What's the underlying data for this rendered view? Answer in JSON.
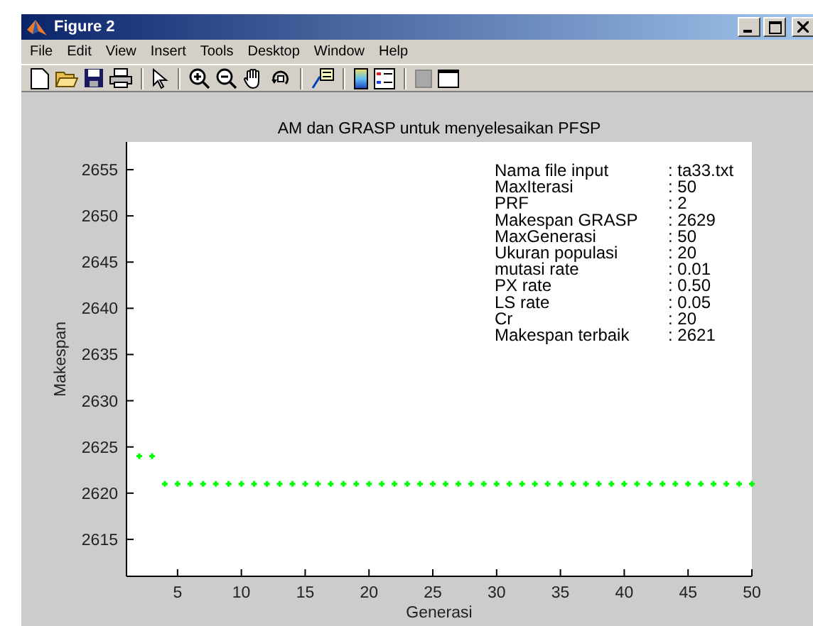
{
  "window": {
    "title": "Figure 2"
  },
  "menu": [
    "File",
    "Edit",
    "View",
    "Insert",
    "Tools",
    "Desktop",
    "Window",
    "Help"
  ],
  "figure": {
    "info": [
      {
        "label": "Nama file input",
        "value": ": ta33.txt"
      },
      {
        "label": "MaxIterasi",
        "value": ": 50"
      },
      {
        "label": "PRF",
        "value": ": 2"
      },
      {
        "label": "Makespan GRASP",
        "value": ": 2629"
      },
      {
        "label": "MaxGenerasi",
        "value": ": 50"
      },
      {
        "label": "Ukuran populasi",
        "value": ": 20"
      },
      {
        "label": "mutasi rate",
        "value": ":  0.01"
      },
      {
        "label": "PX rate",
        "value": ":  0.50"
      },
      {
        "label": "LS rate",
        "value": ": 0.05"
      },
      {
        "label": "Cr",
        "value": ": 20"
      },
      {
        "label": "Makespan terbaik",
        "value": ": 2621"
      }
    ],
    "chart_data": {
      "type": "scatter",
      "title": "AM dan GRASP untuk menyelesaikan PFSP",
      "xlabel": "Generasi",
      "ylabel": "Makespan",
      "x": [
        2,
        3,
        4,
        5,
        6,
        7,
        8,
        9,
        10,
        11,
        12,
        13,
        14,
        15,
        16,
        17,
        18,
        19,
        20,
        21,
        22,
        23,
        24,
        25,
        26,
        27,
        28,
        29,
        30,
        31,
        32,
        33,
        34,
        35,
        36,
        37,
        38,
        39,
        40,
        41,
        42,
        43,
        44,
        45,
        46,
        47,
        48,
        49,
        50
      ],
      "series": [
        {
          "color": "#00ff00",
          "values": [
            2624,
            2624,
            2621,
            2621,
            2621,
            2621,
            2621,
            2621,
            2621,
            2621,
            2621,
            2621,
            2621,
            2621,
            2621,
            2621,
            2621,
            2621,
            2621,
            2621,
            2621,
            2621,
            2621,
            2621,
            2621,
            2621,
            2621,
            2621,
            2621,
            2621,
            2621,
            2621,
            2621,
            2621,
            2621,
            2621,
            2621,
            2621,
            2621,
            2621,
            2621,
            2621,
            2621,
            2621,
            2621,
            2621,
            2621,
            2621,
            2621
          ]
        }
      ],
      "xlim": [
        1,
        50
      ],
      "ylim": [
        2611,
        2658
      ],
      "xticks": [
        5,
        10,
        15,
        20,
        25,
        30,
        35,
        40,
        45,
        50
      ],
      "yticks": [
        2615,
        2620,
        2625,
        2630,
        2635,
        2640,
        2645,
        2650,
        2655
      ]
    }
  }
}
